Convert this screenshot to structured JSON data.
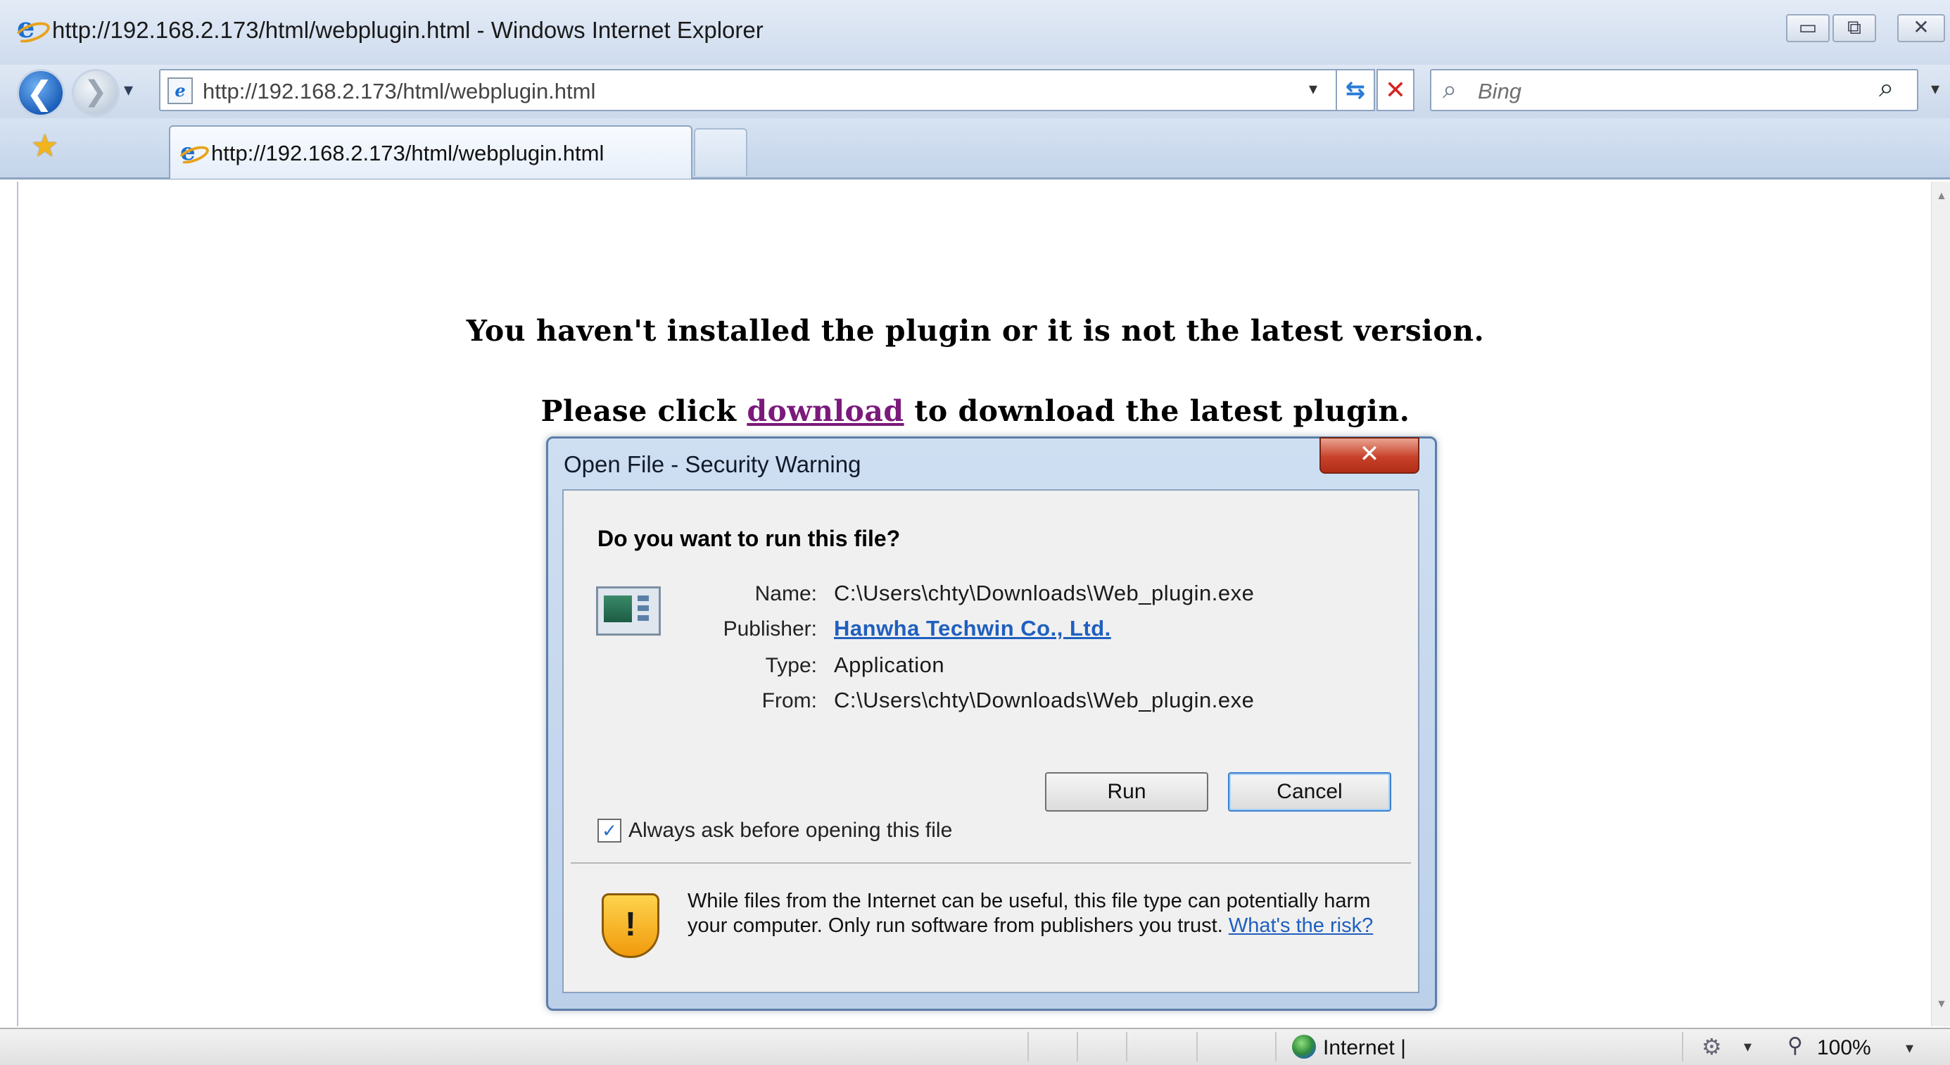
{
  "window": {
    "title": "http://192.168.2.173/html/webplugin.html - Windows Internet Explorer",
    "minimize_glyph": "▭",
    "restore_glyph": "⧉",
    "close_glyph": "✕"
  },
  "navigation": {
    "back_glyph": "❮",
    "forward_glyph": "❯",
    "dropdown_glyph": "▾",
    "address": "http://192.168.2.173/html/webplugin.html",
    "refresh_glyph": "⇆",
    "stop_glyph": "✕",
    "search_placeholder": "Bing",
    "search_glyph": "⌕"
  },
  "tabs": [
    {
      "label": "http://192.168.2.173/html/webplugin.html",
      "active": true
    }
  ],
  "page": {
    "line1": "You haven't installed the plugin or it is not the latest version.",
    "line2_before": "Please click ",
    "line2_link": "download",
    "line2_after": " to download the latest plugin."
  },
  "dialog": {
    "title": "Open File - Security Warning",
    "close_glyph": "✕",
    "question": "Do you want to run this file?",
    "fields": [
      {
        "label": "Name:",
        "value": "C:\\Users\\chty\\Downloads\\Web_plugin.exe"
      },
      {
        "label": "Publisher:",
        "value": "Hanwha Techwin Co., Ltd."
      },
      {
        "label": "Type:",
        "value": "Application"
      },
      {
        "label": "From:",
        "value": "C:\\Users\\chty\\Downloads\\Web_plugin.exe"
      }
    ],
    "run_label": "Run",
    "cancel_label": "Cancel",
    "checkbox_label": "Always ask before opening this file",
    "checkbox_checked": true,
    "warning_text": "While files from the Internet can be useful, this file type can potentially harm your computer. Only run software from publishers you trust.",
    "risk_link": "What's the risk?"
  },
  "status": {
    "zone": "Internet |",
    "zoom": "100%"
  },
  "icons": {
    "app": "ie-logo-icon",
    "favorites": "star-icon",
    "globe": "globe-icon",
    "shield": "shield-warning-icon",
    "zoom": "magnifier-icon"
  },
  "colors": {
    "chrome_blue": "#cbd9ec",
    "link_visited": "#7b1a7b",
    "link_blue": "#1f5fbf",
    "dialog_close_red": "#c8412a"
  }
}
